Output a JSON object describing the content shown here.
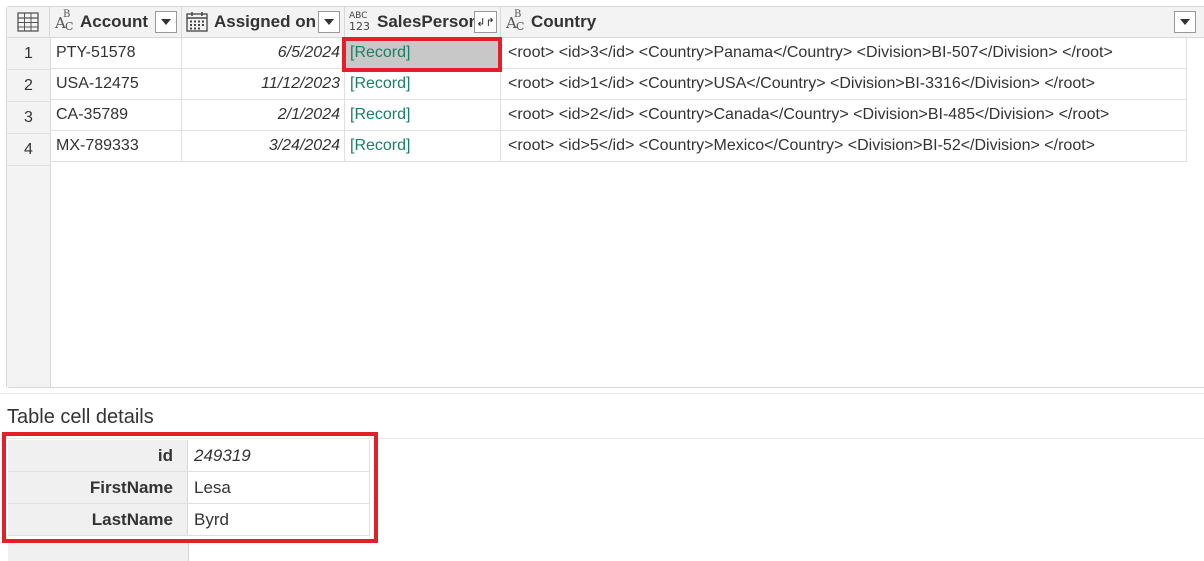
{
  "columns": [
    {
      "name": "Account",
      "type_icon": "text-type-icon"
    },
    {
      "name": "Assigned on",
      "type_icon": "date-type-icon"
    },
    {
      "name": "SalesPerson",
      "type_icon": "any-type-icon",
      "type_top": "ABC",
      "type_bottom": "123"
    },
    {
      "name": "Country",
      "type_icon": "text-type-icon"
    }
  ],
  "rows": [
    {
      "num": "1",
      "account": "PTY-51578",
      "assigned": "6/5/2024",
      "salesperson": "[Record]",
      "country": "<root> <id>3</id> <Country>Panama</Country> <Division>BI-507</Division> </root>"
    },
    {
      "num": "2",
      "account": "USA-12475",
      "assigned": "11/12/2023",
      "salesperson": "[Record]",
      "country": "<root> <id>1</id> <Country>USA</Country> <Division>BI-3316</Division> </root>"
    },
    {
      "num": "3",
      "account": "CA-35789",
      "assigned": "2/1/2024",
      "salesperson": "[Record]",
      "country": "<root> <id>2</id> <Country>Canada</Country> <Division>BI-485</Division> </root>"
    },
    {
      "num": "4",
      "account": "MX-789333",
      "assigned": "3/24/2024",
      "salesperson": "[Record]",
      "country": "<root> <id>5</id> <Country>Mexico</Country> <Division>BI-52</Division> </root>"
    }
  ],
  "details": {
    "title": "Table cell details",
    "fields": [
      {
        "key": "id",
        "value": "249319"
      },
      {
        "key": "FirstName",
        "value": "Lesa"
      },
      {
        "key": "LastName",
        "value": "Byrd"
      }
    ]
  },
  "colors": {
    "highlight": "#e3202a",
    "record_link": "#1a7f64"
  }
}
